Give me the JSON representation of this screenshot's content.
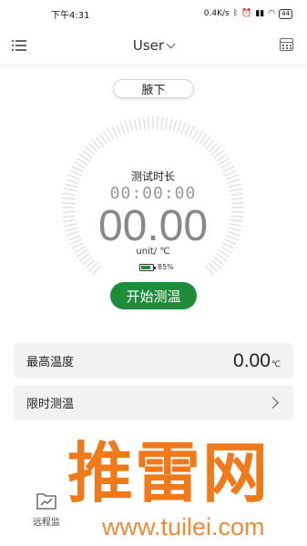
{
  "status_bar": {
    "time": "下午4:31",
    "speed": "0.4K/s",
    "battery": "44"
  },
  "header": {
    "title": "User"
  },
  "position_selector": {
    "label": "腋下"
  },
  "dial": {
    "duration_label": "测试时长",
    "timer": "00:00:00",
    "temperature": "00.00",
    "unit": "unit/ ℃",
    "battery_percent_text": "85%",
    "battery_level": 0.85
  },
  "start_button": {
    "label": "开始测温"
  },
  "max_temp_card": {
    "label": "最高温度",
    "value": "0.00",
    "unit": "℃"
  },
  "timed_card": {
    "label": "限时测温"
  },
  "bottom_nav": {
    "remote_label": "远程监"
  },
  "watermark": {
    "main": "推雷网",
    "url": "www.tuilei.com"
  },
  "colors": {
    "accent_green": "#1f8c3a",
    "watermark_orange": "#f07a1a",
    "card_bg": "#f2f2f2"
  }
}
